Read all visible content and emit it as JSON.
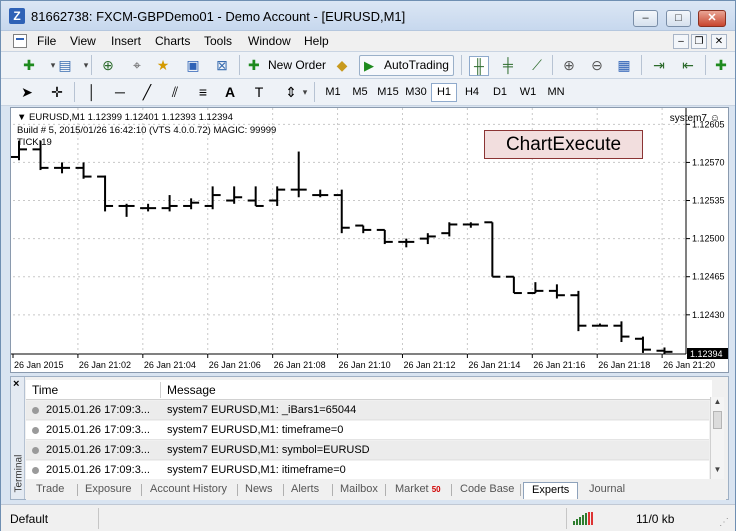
{
  "window": {
    "title": "81662738: FXCM-GBPDemo01 - Demo Account - [EURUSD,M1]",
    "minimize": "‒",
    "maximize": "□",
    "close": "✕"
  },
  "menu": {
    "items": [
      "File",
      "View",
      "Insert",
      "Charts",
      "Tools",
      "Window",
      "Help"
    ],
    "mdi_minimize": "‒",
    "mdi_restore": "❐",
    "mdi_close": "✕"
  },
  "toolbar": {
    "new_order": "New Order",
    "autotrading": "AutoTrading"
  },
  "timeframes": [
    "M1",
    "M5",
    "M15",
    "M30",
    "H1",
    "H4",
    "D1",
    "W1",
    "MN"
  ],
  "active_timeframe": "H1",
  "chart": {
    "symbol_line": "EURUSD,M1  1.12399 1.12401 1.12393 1.12394",
    "build_line": "Build # 5, 2015/01/26 16:42:10  (VTS 4.0.0.72) MAGIC: 99999",
    "tick_line": "TICK:19",
    "expert_name": "system7 ☺",
    "exec_button": "ChartExecute",
    "current_price": "1.12394"
  },
  "chart_data": {
    "type": "bar",
    "price_axis": [
      "1.12605",
      "1.12570",
      "1.12535",
      "1.12500",
      "1.12465",
      "1.12430"
    ],
    "time_axis": [
      "26 Jan 2015",
      "26 Jan 21:02",
      "26 Jan 21:04",
      "26 Jan 21:06",
      "26 Jan 21:08",
      "26 Jan 21:10",
      "26 Jan 21:12",
      "26 Jan 21:14",
      "26 Jan 21:16",
      "26 Jan 21:18",
      "26 Jan 21:20"
    ],
    "ylim": [
      1.12394,
      1.1262
    ],
    "bars": [
      {
        "o": 1.12575,
        "h": 1.1259,
        "l": 1.12572,
        "c": 1.12582
      },
      {
        "o": 1.12582,
        "h": 1.1259,
        "l": 1.12563,
        "c": 1.12565
      },
      {
        "o": 1.12565,
        "h": 1.1257,
        "l": 1.1256,
        "c": 1.12565
      },
      {
        "o": 1.12565,
        "h": 1.1257,
        "l": 1.12555,
        "c": 1.12557
      },
      {
        "o": 1.12557,
        "h": 1.12558,
        "l": 1.12525,
        "c": 1.1253
      },
      {
        "o": 1.1253,
        "h": 1.12532,
        "l": 1.1252,
        "c": 1.1253
      },
      {
        "o": 1.12528,
        "h": 1.12532,
        "l": 1.12525,
        "c": 1.12528
      },
      {
        "o": 1.12528,
        "h": 1.1254,
        "l": 1.12525,
        "c": 1.1253
      },
      {
        "o": 1.1253,
        "h": 1.12537,
        "l": 1.12527,
        "c": 1.12533
      },
      {
        "o": 1.1253,
        "h": 1.12548,
        "l": 1.12527,
        "c": 1.1254
      },
      {
        "o": 1.12535,
        "h": 1.12548,
        "l": 1.12532,
        "c": 1.12538
      },
      {
        "o": 1.12535,
        "h": 1.12548,
        "l": 1.1253,
        "c": 1.1253
      },
      {
        "o": 1.12535,
        "h": 1.12548,
        "l": 1.1253,
        "c": 1.12545
      },
      {
        "o": 1.12545,
        "h": 1.1258,
        "l": 1.12538,
        "c": 1.12545
      },
      {
        "o": 1.1254,
        "h": 1.12545,
        "l": 1.12538,
        "c": 1.1254
      },
      {
        "o": 1.1254,
        "h": 1.12545,
        "l": 1.12505,
        "c": 1.1251
      },
      {
        "o": 1.12512,
        "h": 1.12512,
        "l": 1.12505,
        "c": 1.12508
      },
      {
        "o": 1.12508,
        "h": 1.12508,
        "l": 1.12495,
        "c": 1.12497
      },
      {
        "o": 1.12497,
        "h": 1.125,
        "l": 1.12492,
        "c": 1.12497
      },
      {
        "o": 1.125,
        "h": 1.12505,
        "l": 1.12495,
        "c": 1.12502
      },
      {
        "o": 1.12505,
        "h": 1.12515,
        "l": 1.12502,
        "c": 1.12513
      },
      {
        "o": 1.12513,
        "h": 1.12515,
        "l": 1.1251,
        "c": 1.12513
      },
      {
        "o": 1.12515,
        "h": 1.12515,
        "l": 1.12465,
        "c": 1.12465
      },
      {
        "o": 1.12465,
        "h": 1.12465,
        "l": 1.1245,
        "c": 1.1245
      },
      {
        "o": 1.1245,
        "h": 1.1246,
        "l": 1.1245,
        "c": 1.12452
      },
      {
        "o": 1.12452,
        "h": 1.12458,
        "l": 1.12445,
        "c": 1.12448
      },
      {
        "o": 1.12448,
        "h": 1.12452,
        "l": 1.12415,
        "c": 1.1242
      },
      {
        "o": 1.1242,
        "h": 1.12422,
        "l": 1.1242,
        "c": 1.1242
      },
      {
        "o": 1.1242,
        "h": 1.12424,
        "l": 1.12405,
        "c": 1.1241
      },
      {
        "o": 1.12408,
        "h": 1.1241,
        "l": 1.12395,
        "c": 1.12398
      },
      {
        "o": 1.12397,
        "h": 1.124,
        "l": 1.12394,
        "c": 1.12396
      }
    ]
  },
  "terminal": {
    "label": "Terminal",
    "close": "×",
    "columns": {
      "time": "Time",
      "message": "Message"
    },
    "rows": [
      {
        "time": "2015.01.26 17:09:3...",
        "message": "system7 EURUSD,M1: _iBars1=65044"
      },
      {
        "time": "2015.01.26 17:09:3...",
        "message": "system7 EURUSD,M1: timeframe=0"
      },
      {
        "time": "2015.01.26 17:09:3...",
        "message": "system7 EURUSD,M1: symbol=EURUSD"
      },
      {
        "time": "2015.01.26 17:09:3...",
        "message": "system7 EURUSD,M1: itimeframe=0"
      }
    ],
    "tabs": [
      "Trade",
      "Exposure",
      "Account History",
      "News",
      "Alerts",
      "Mailbox",
      "Market",
      "Code Base",
      "Experts",
      "Journal"
    ],
    "market_badge": "50",
    "active_tab": "Experts"
  },
  "status": {
    "profile": "Default",
    "traffic": "11/0 kb"
  },
  "colors": {
    "exec_button_bg": "#f2dede",
    "market_badge": "#d10000"
  }
}
